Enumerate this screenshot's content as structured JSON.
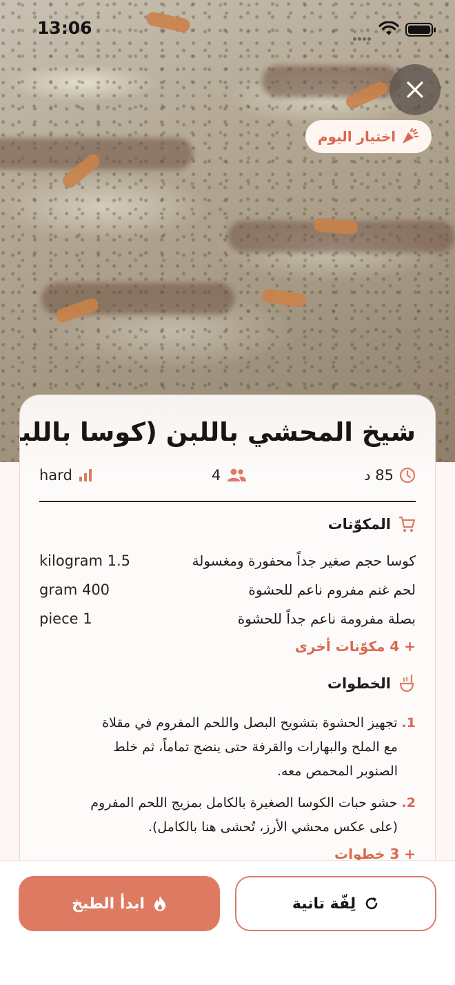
{
  "status_bar": {
    "time": "13:06"
  },
  "badge": {
    "label": "اختيار اليوم"
  },
  "recipe": {
    "title": "شيخ المحشي باللبن (كوسا باللبن)",
    "time": "85 د",
    "servings": "4",
    "difficulty": "hard"
  },
  "ingredients": {
    "heading": "المكوّنات",
    "items": [
      {
        "name": "كوسا حجم صغير جداً محفورة ومغسولة",
        "qty": "kilogram 1.5"
      },
      {
        "name": "لحم غنم مفروم ناعم للحشوة",
        "qty": "gram 400"
      },
      {
        "name": "بصلة مفرومة ناعم جداً للحشوة",
        "qty": "piece 1"
      }
    ],
    "more": "+ 4 مكوّنات أخرى"
  },
  "steps": {
    "heading": "الخطوات",
    "items": [
      {
        "num": "1.",
        "lines": [
          "تجهيز الحشوة بتشويح البصل واللحم المفروم في مقلاة",
          "مع الملح والبهارات والقرفة حتى ينضج تماماً، ثم خلط",
          "الصنوبر المحمص معه."
        ]
      },
      {
        "num": "2.",
        "lines": [
          "حشو حبات الكوسا الصغيرة بالكامل بمزيج اللحم المفروم",
          "(على عكس محشي الأرز، تُحشى هنا بالكامل)."
        ]
      }
    ],
    "more": "+ 3 خطوات"
  },
  "actions": {
    "start": "ابدأ الطبخ",
    "again": "لِفّة تانية"
  },
  "colors": {
    "accent": "#df7a62",
    "accent_text": "#d9684e"
  },
  "icons": [
    "close-icon",
    "sparkle-icon",
    "clock-icon",
    "people-icon",
    "signal-bars-icon",
    "cart-icon",
    "ladle-icon",
    "flame-icon",
    "refresh-icon"
  ]
}
